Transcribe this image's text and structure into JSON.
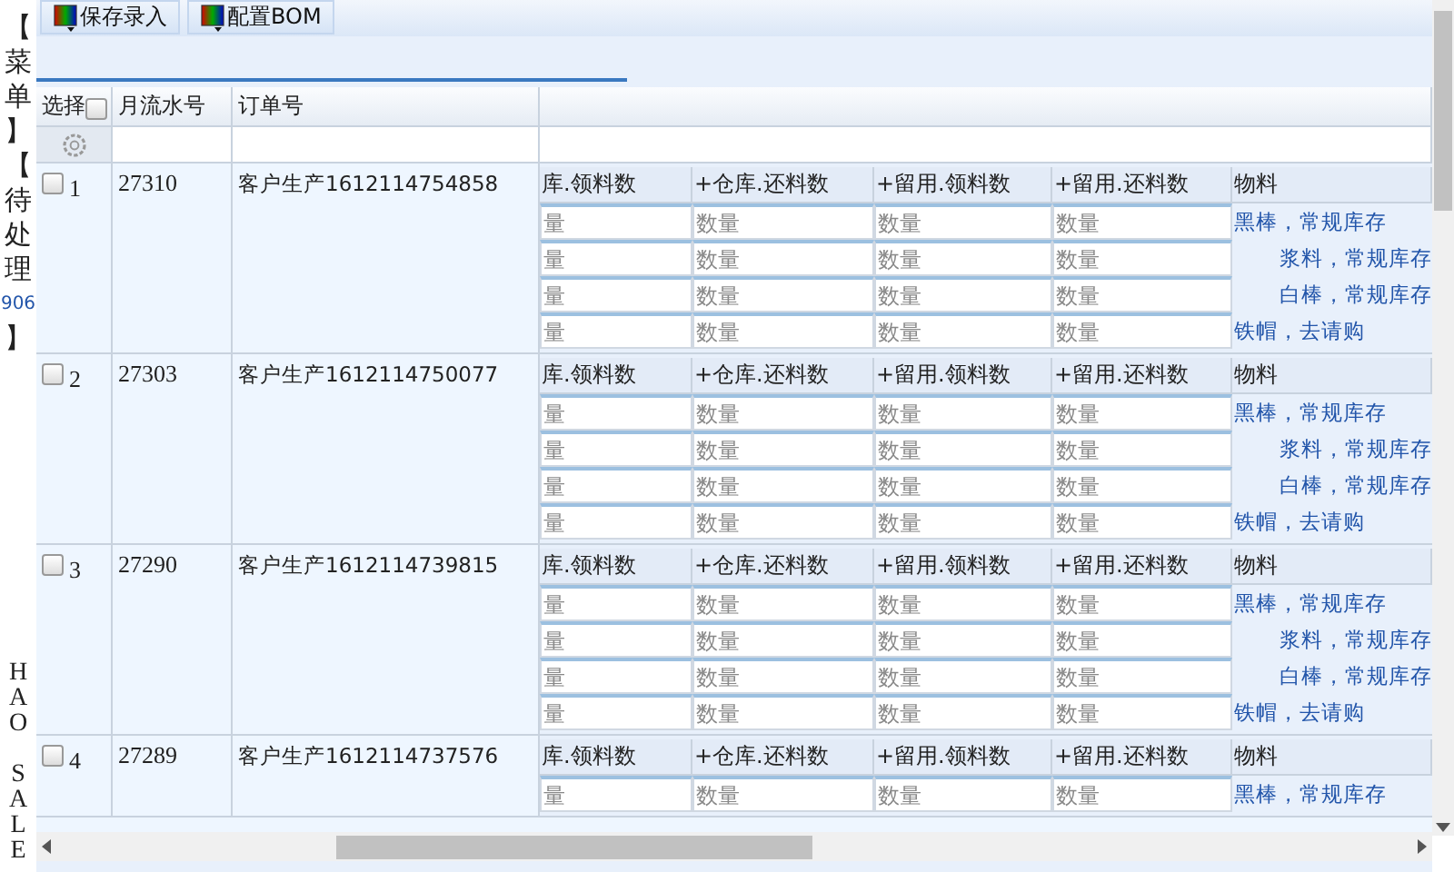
{
  "sidebar": {
    "items": [
      {
        "text": "【菜单】",
        "kind": "plain"
      },
      {
        "text": "【待处理",
        "kind": "plain"
      },
      {
        "text": "906",
        "kind": "link"
      },
      {
        "text": "】",
        "kind": "plain"
      },
      {
        "text": "HAO SALE",
        "kind": "footer"
      }
    ]
  },
  "toolbar": {
    "buttons": [
      {
        "label": "保存录入"
      },
      {
        "label": "配置BOM"
      }
    ]
  },
  "table": {
    "columns": [
      "选择",
      "月流水号",
      "订单号"
    ],
    "select_all": {
      "checked": false
    },
    "rows": [
      {
        "index": "1",
        "checked": false,
        "serial": "27310",
        "order": "客户生产1612114754858",
        "detail_columns": [
          "库.领料数",
          "+仓库.还料数",
          "+留用.领料数",
          "+留用.还料数",
          "物料"
        ],
        "lines": [
          {
            "placeholders": [
              "量",
              "数量",
              "数量",
              "数量"
            ],
            "material": "黑棒，常规库存",
            "kind": "plain"
          },
          {
            "placeholders": [
              "量",
              "数量",
              "数量",
              "数量"
            ],
            "material": "浆料，常规库存",
            "kind": "indented"
          },
          {
            "placeholders": [
              "量",
              "数量",
              "数量",
              "数量"
            ],
            "material": "白棒，常规库存",
            "kind": "indented"
          },
          {
            "placeholders": [
              "量",
              "数量",
              "数量",
              "数量"
            ],
            "material": "铁帽，去请购",
            "kind": "plain"
          }
        ]
      },
      {
        "index": "2",
        "checked": false,
        "serial": "27303",
        "order": "客户生产1612114750077",
        "detail_columns": [
          "库.领料数",
          "+仓库.还料数",
          "+留用.领料数",
          "+留用.还料数",
          "物料"
        ],
        "lines": [
          {
            "placeholders": [
              "量",
              "数量",
              "数量",
              "数量"
            ],
            "material": "黑棒，常规库存",
            "kind": "plain"
          },
          {
            "placeholders": [
              "量",
              "数量",
              "数量",
              "数量"
            ],
            "material": "浆料，常规库存",
            "kind": "indented"
          },
          {
            "placeholders": [
              "量",
              "数量",
              "数量",
              "数量"
            ],
            "material": "白棒，常规库存",
            "kind": "indented"
          },
          {
            "placeholders": [
              "量",
              "数量",
              "数量",
              "数量"
            ],
            "material": "铁帽，去请购",
            "kind": "plain"
          }
        ]
      },
      {
        "index": "3",
        "checked": false,
        "serial": "27290",
        "order": "客户生产1612114739815",
        "detail_columns": [
          "库.领料数",
          "+仓库.还料数",
          "+留用.领料数",
          "+留用.还料数",
          "物料"
        ],
        "lines": [
          {
            "placeholders": [
              "量",
              "数量",
              "数量",
              "数量"
            ],
            "material": "黑棒，常规库存",
            "kind": "plain"
          },
          {
            "placeholders": [
              "量",
              "数量",
              "数量",
              "数量"
            ],
            "material": "浆料，常规库存",
            "kind": "indented"
          },
          {
            "placeholders": [
              "量",
              "数量",
              "数量",
              "数量"
            ],
            "material": "白棒，常规库存",
            "kind": "indented"
          },
          {
            "placeholders": [
              "量",
              "数量",
              "数量",
              "数量"
            ],
            "material": "铁帽，去请购",
            "kind": "plain"
          }
        ]
      },
      {
        "index": "4",
        "checked": false,
        "serial": "27289",
        "order": "客户生产1612114737576",
        "detail_columns": [
          "库.领料数",
          "+仓库.还料数",
          "+留用.领料数",
          "+留用.还料数",
          "物料"
        ],
        "lines": [
          {
            "placeholders": [
              "量",
              "数量",
              "数量",
              "数量"
            ],
            "material": "黑棒，常规库存",
            "kind": "plain"
          }
        ]
      }
    ]
  }
}
